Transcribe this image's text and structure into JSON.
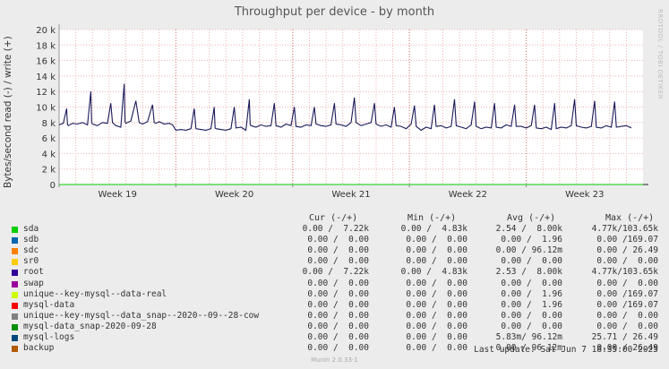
{
  "title": "Throughput per device - by month",
  "side_label": "RRDTOOL / TOBI OETIKER",
  "ylabel": "Bytes/second read (-) / write (+)",
  "chart_data": {
    "type": "line",
    "title": "Throughput per device - by month",
    "ylabel": "Bytes/second read (-) / write (+)",
    "ylim": [
      0,
      20000
    ],
    "y_ticks": [
      0,
      2000,
      4000,
      6000,
      8000,
      10000,
      12000,
      14000,
      16000,
      18000,
      20000
    ],
    "y_tick_labels": [
      "0",
      "2 k",
      "4 k",
      "6 k",
      "8 k",
      "10 k",
      "12 k",
      "14 k",
      "16 k",
      "18 k",
      "20 k"
    ],
    "x_tick_labels": [
      "Week 19",
      "Week 20",
      "Week 21",
      "Week 22",
      "Week 23"
    ],
    "x_range_days": [
      0,
      35
    ],
    "x_week_starts": [
      0,
      7,
      14,
      21,
      28
    ],
    "grid": true,
    "series": [
      {
        "name": "root",
        "color": "#1a1a5a",
        "x_days": [
          0.0,
          0.25,
          0.45,
          0.5,
          0.55,
          0.8,
          1.1,
          1.4,
          1.7,
          1.9,
          1.95,
          2.0,
          2.3,
          2.6,
          2.9,
          3.1,
          3.2,
          3.4,
          3.7,
          3.9,
          3.95,
          4.0,
          4.3,
          4.6,
          4.8,
          4.9,
          5.0,
          5.3,
          5.6,
          5.7,
          5.8,
          6.0,
          6.3,
          6.6,
          6.8,
          7.0,
          7.3,
          7.6,
          7.9,
          8.1,
          8.2,
          8.5,
          8.8,
          9.1,
          9.3,
          9.35,
          9.4,
          9.7,
          10.0,
          10.3,
          10.5,
          10.6,
          10.9,
          11.2,
          11.4,
          11.45,
          11.5,
          11.8,
          12.1,
          12.4,
          12.7,
          12.9,
          13.0,
          13.3,
          13.6,
          13.9,
          14.1,
          14.2,
          14.5,
          14.8,
          15.1,
          15.3,
          15.4,
          15.7,
          16.0,
          16.3,
          16.5,
          16.6,
          16.9,
          17.2,
          17.5,
          17.7,
          17.8,
          18.1,
          18.4,
          18.7,
          18.9,
          19.0,
          19.3,
          19.6,
          19.9,
          20.1,
          20.2,
          20.5,
          20.8,
          21.1,
          21.3,
          21.4,
          21.7,
          22.0,
          22.3,
          22.5,
          22.6,
          22.9,
          23.2,
          23.5,
          23.7,
          23.8,
          24.1,
          24.4,
          24.7,
          24.9,
          25.0,
          25.3,
          25.6,
          25.9,
          26.1,
          26.2,
          26.5,
          26.8,
          27.1,
          27.3,
          27.4,
          27.7,
          28.0,
          28.3,
          28.5,
          28.6,
          28.9,
          29.2,
          29.5,
          29.7,
          29.8,
          30.1,
          30.4,
          30.7,
          30.9,
          31.0,
          31.3,
          31.6,
          31.9,
          32.1,
          32.2,
          32.5,
          32.8,
          33.1,
          33.3,
          33.4,
          33.7,
          34.0,
          34.3,
          34.6,
          35.0
        ],
        "values": [
          7700,
          7900,
          9800,
          7800,
          7600,
          7900,
          7800,
          8000,
          7700,
          12000,
          8000,
          7800,
          7600,
          8000,
          7900,
          10500,
          8000,
          7600,
          7400,
          13000,
          8100,
          7900,
          8200,
          10800,
          8000,
          7900,
          7800,
          8100,
          10300,
          8000,
          7900,
          8100,
          7800,
          7900,
          7700,
          7000,
          7100,
          7000,
          7200,
          9800,
          7200,
          7100,
          7000,
          7200,
          10000,
          7300,
          7200,
          7100,
          7000,
          7200,
          10000,
          7300,
          7400,
          7000,
          11000,
          7800,
          7600,
          7400,
          7700,
          7500,
          7600,
          10500,
          7600,
          7400,
          7800,
          7600,
          10000,
          7500,
          7400,
          7700,
          7600,
          10000,
          7800,
          7600,
          7500,
          7700,
          10500,
          7800,
          7700,
          7500,
          8000,
          11200,
          8000,
          7600,
          7800,
          8000,
          10500,
          7800,
          7500,
          7700,
          7400,
          10000,
          7600,
          7500,
          7200,
          7800,
          10200,
          7500,
          7000,
          7400,
          7200,
          10300,
          7500,
          7600,
          7300,
          7500,
          11000,
          7600,
          7400,
          7200,
          7700,
          10700,
          7500,
          7200,
          7400,
          7300,
          10500,
          7400,
          7300,
          7700,
          7500,
          10300,
          7500,
          7500,
          7300,
          7600,
          10300,
          7300,
          7200,
          7400,
          7100,
          10500,
          7200,
          7400,
          7300,
          7600,
          11000,
          7600,
          7400,
          7300,
          7500,
          10800,
          7400,
          7300,
          7600,
          7400,
          10700,
          7400,
          7500,
          7600,
          7300
        ]
      },
      {
        "name": "sda",
        "color": "#00cc00",
        "x_days": [
          0,
          35
        ],
        "values": [
          0,
          0
        ]
      }
    ]
  },
  "legend_headers": {
    "cur": "Cur (-/+)",
    "min": "Min (-/+)",
    "avg": "Avg (-/+)",
    "max": "Max (-/+)"
  },
  "legend": [
    {
      "name": "sda",
      "color": "#00cc00",
      "cur": "0.00 /  7.22k",
      "min": "0.00 /  4.83k",
      "avg": "2.54 /  8.00k",
      "max": "4.77k/103.65k"
    },
    {
      "name": "sdb",
      "color": "#0066b3",
      "cur": "0.00 /  0.00",
      "min": "0.00 /  0.00",
      "avg": "0.00 /  1.96",
      "max": "0.00 /169.07"
    },
    {
      "name": "sdc",
      "color": "#ff8000",
      "cur": "0.00 /  0.00",
      "min": "0.00 /  0.00",
      "avg": "0.00 / 96.12m",
      "max": "0.00 / 26.49"
    },
    {
      "name": "sr0",
      "color": "#ffcc00",
      "cur": "0.00 /  0.00",
      "min": "0.00 /  0.00",
      "avg": "0.00 /  0.00",
      "max": "0.00 /  0.00"
    },
    {
      "name": "root",
      "color": "#330099",
      "cur": "0.00 /  7.22k",
      "min": "0.00 /  4.83k",
      "avg": "2.53 /  8.00k",
      "max": "4.77k/103.65k"
    },
    {
      "name": "swap",
      "color": "#990099",
      "cur": "0.00 /  0.00",
      "min": "0.00 /  0.00",
      "avg": "0.00 /  0.00",
      "max": "0.00 /  0.00"
    },
    {
      "name": "unique--key-mysql--data-real",
      "color": "#ccff00",
      "cur": "0.00 /  0.00",
      "min": "0.00 /  0.00",
      "avg": "0.00 /  1.96",
      "max": "0.00 /169.07"
    },
    {
      "name": "mysql-data",
      "color": "#ff0000",
      "cur": "0.00 /  0.00",
      "min": "0.00 /  0.00",
      "avg": "0.00 /  1.96",
      "max": "0.00 /169.07"
    },
    {
      "name": "unique--key-mysql--data_snap--2020--09--28-cow",
      "color": "#808080",
      "cur": "0.00 /  0.00",
      "min": "0.00 /  0.00",
      "avg": "0.00 /  0.00",
      "max": "0.00 /  0.00"
    },
    {
      "name": "mysql-data_snap-2020-09-28",
      "color": "#008f00",
      "cur": "0.00 /  0.00",
      "min": "0.00 /  0.00",
      "avg": "0.00 /  0.00",
      "max": "0.00 /  0.00"
    },
    {
      "name": "mysql-logs",
      "color": "#00487d",
      "cur": "0.00 /  0.00",
      "min": "0.00 /  0.00",
      "avg": "5.83m/ 96.12m",
      "max": "25.71 / 26.49"
    },
    {
      "name": "backup",
      "color": "#b35a00",
      "cur": "0.00 /  0.00",
      "min": "0.00 /  0.00",
      "avg": "0.00 / 96.12m",
      "max": "0.00 / 26.49"
    }
  ],
  "last_update": "Last update:  Sat Jun  7 18:35:00 2025",
  "footer": "Munin 2.0.33-1"
}
